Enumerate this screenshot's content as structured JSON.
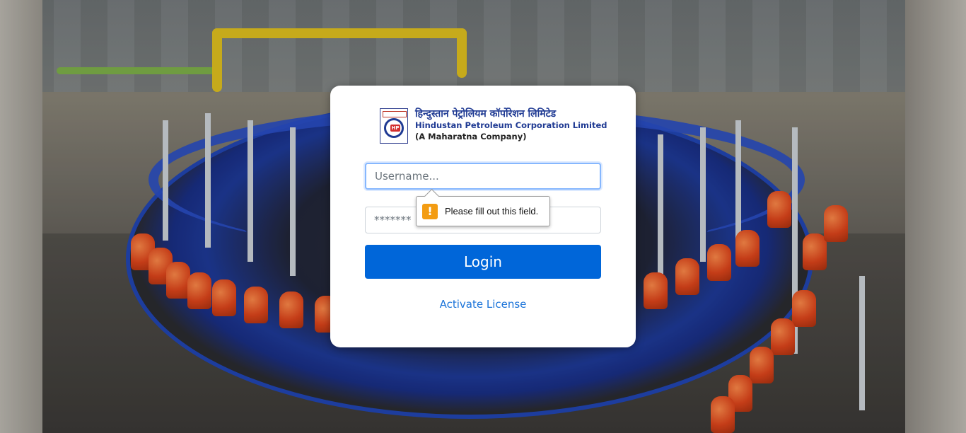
{
  "background": {
    "description_icon": "factory-lpg-carousel-image"
  },
  "logo": {
    "hindi_name": "हिन्दुस्तान पेट्रोलियम कॉर्पोरेशन लिमिटेड",
    "english_name": "Hindustan Petroleum Corporation Limited",
    "tagline": "(A Maharatna Company)",
    "mark_text": "HP",
    "brand_color": "#1f3a93",
    "accent_color": "#d32f2f"
  },
  "form": {
    "username_placeholder": "Username...",
    "username_value": "",
    "password_placeholder": "*******",
    "password_value": "",
    "login_label": "Login",
    "activate_label": "Activate License"
  },
  "validation": {
    "message": "Please fill out this field.",
    "icon": "!"
  },
  "colors": {
    "primary": "#0066d9",
    "link": "#1a73d9",
    "warning": "#f39c12"
  }
}
